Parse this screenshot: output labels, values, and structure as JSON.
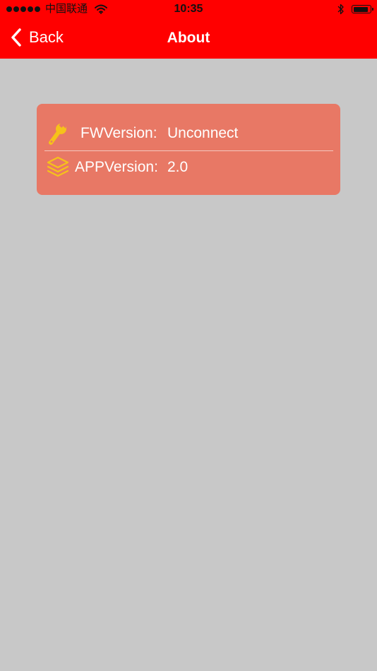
{
  "status_bar": {
    "carrier": "中国联通",
    "time": "10:35",
    "signal_bars": 5
  },
  "nav": {
    "back_label": "Back",
    "title": "About"
  },
  "info": {
    "fw_label": "FWVersion:",
    "fw_value": "Unconnect",
    "app_label": "APPVersion:",
    "app_value": "2.0"
  },
  "colors": {
    "nav_background": "#ff0000",
    "page_background": "#c8c8c8",
    "card_background": "#e87865",
    "icon_accent": "#f6c21a",
    "text": "#ffffff"
  },
  "icons": {
    "fw": "wrench-icon",
    "app": "layers-icon",
    "back": "chevron-left-icon"
  }
}
